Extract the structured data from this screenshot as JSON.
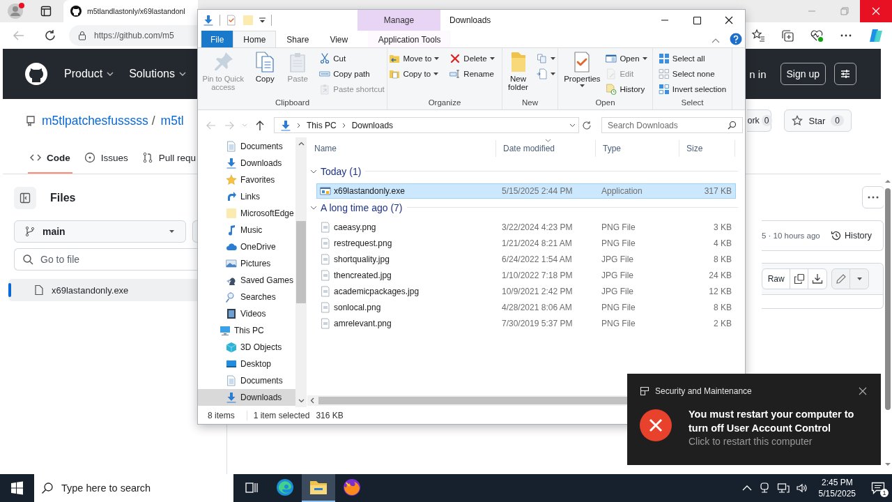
{
  "browser": {
    "tab": {
      "title": "m5tlandlastonly/x69lastandonl"
    },
    "url": "https://github.com/m5"
  },
  "github": {
    "nav": [
      "Product",
      "Solutions"
    ],
    "sign_in": "n in",
    "sign_up": "Sign up",
    "repo": {
      "owner": "m5tlpatchesfusssss",
      "separator": "/",
      "name": "m5tl"
    },
    "tabs": [
      {
        "label": "Code",
        "selected": true
      },
      {
        "label": "Issues",
        "selected": false
      },
      {
        "label": "Pull requ",
        "selected": false
      }
    ],
    "fork": {
      "label": "ork",
      "count": "0"
    },
    "star": {
      "label": "Star",
      "count": "0"
    },
    "sidebar": {
      "title": "Files",
      "branch": "main",
      "search": {
        "placeholder": "Go to file"
      },
      "files": [
        {
          "name": "x69lastandonly.exe",
          "selected": true
        }
      ]
    },
    "commit": {
      "info": "5 · 10 hours ago",
      "history": "History"
    },
    "file_toolbar": {
      "raw": "Raw"
    }
  },
  "explorer": {
    "title": "Downloads",
    "context_tab": "Manage",
    "ribbon_tabs": [
      {
        "label": "File",
        "kind": "file",
        "selected": false
      },
      {
        "label": "Home",
        "kind": "tab",
        "selected": true
      },
      {
        "label": "Share",
        "kind": "tab",
        "selected": false
      },
      {
        "label": "View",
        "kind": "tab",
        "selected": false
      },
      {
        "label": "Application Tools",
        "kind": "context",
        "selected": false
      }
    ],
    "ribbon_groups": [
      {
        "label": "Clipboard",
        "columns": [
          [
            {
              "label": "Pin to Quick access",
              "kind": "large",
              "menu": false,
              "disabled": true
            }
          ],
          [
            {
              "label": "Copy",
              "kind": "large",
              "menu": false,
              "disabled": false
            }
          ],
          [
            {
              "label": "Paste",
              "kind": "large",
              "menu": false,
              "disabled": true
            }
          ],
          [
            {
              "label": "Cut",
              "kind": "small",
              "menu": false,
              "disabled": false
            },
            {
              "label": "Copy path",
              "kind": "small",
              "menu": false,
              "disabled": false
            },
            {
              "label": "Paste shortcut",
              "kind": "small",
              "menu": false,
              "disabled": true
            }
          ]
        ]
      },
      {
        "label": "Organize",
        "columns": [
          [
            {
              "label": "Move to",
              "kind": "small",
              "menu": true,
              "disabled": false
            },
            {
              "label": "Copy to",
              "kind": "small",
              "menu": true,
              "disabled": false
            }
          ],
          [
            {
              "label": "Delete",
              "kind": "small",
              "menu": true,
              "disabled": false
            },
            {
              "label": "Rename",
              "kind": "small",
              "menu": false,
              "disabled": false
            }
          ]
        ]
      },
      {
        "label": "New",
        "columns": [
          [
            {
              "label": "New folder",
              "kind": "large",
              "menu": false,
              "disabled": false
            }
          ],
          [
            {
              "kind": "icon",
              "menu": true,
              "disabled": false
            },
            {
              "kind": "icon",
              "menu": true,
              "disabled": false
            }
          ]
        ]
      },
      {
        "label": "Open",
        "columns": [
          [
            {
              "label": "Properties",
              "kind": "large",
              "menu": true,
              "disabled": false
            }
          ],
          [
            {
              "label": "Open",
              "kind": "small",
              "menu": true,
              "disabled": false
            },
            {
              "label": "Edit",
              "kind": "small",
              "menu": false,
              "disabled": true
            },
            {
              "label": "History",
              "kind": "small",
              "menu": false,
              "disabled": false
            }
          ]
        ]
      },
      {
        "label": "Select",
        "columns": [
          [
            {
              "label": "Select all",
              "kind": "small",
              "menu": false,
              "disabled": false
            },
            {
              "label": "Select none",
              "kind": "small",
              "menu": false,
              "disabled": false
            },
            {
              "label": "Invert selection",
              "kind": "small",
              "menu": false,
              "disabled": false
            }
          ]
        ]
      }
    ],
    "navigation": {
      "back": {
        "disabled": true
      },
      "forward": {
        "disabled": true
      },
      "up": {
        "disabled": false
      }
    },
    "address": {
      "path": [
        "This PC",
        "Downloads"
      ]
    },
    "search": {
      "placeholder": "Search Downloads"
    },
    "nav_pane": {
      "folders": [
        {
          "label": "Documents",
          "selected": false
        },
        {
          "label": "Downloads",
          "selected": false
        },
        {
          "label": "Favorites",
          "selected": false
        },
        {
          "label": "Links",
          "selected": false
        },
        {
          "label": "MicrosoftEdge",
          "selected": false
        },
        {
          "label": "Music",
          "selected": false
        },
        {
          "label": "OneDrive",
          "selected": false
        },
        {
          "label": "Pictures",
          "selected": false
        },
        {
          "label": "Saved Games",
          "selected": false
        },
        {
          "label": "Searches",
          "selected": false
        },
        {
          "label": "Videos",
          "selected": false
        }
      ],
      "this_pc": {
        "label": "This PC",
        "selected": false,
        "children": [
          {
            "label": "3D Objects",
            "selected": false
          },
          {
            "label": "Desktop",
            "selected": false
          },
          {
            "label": "Documents",
            "selected": false
          },
          {
            "label": "Downloads",
            "selected": true
          }
        ]
      }
    },
    "columns": [
      {
        "label": "Name",
        "sorted": false
      },
      {
        "label": "Date modified",
        "sorted": true
      },
      {
        "label": "Type",
        "sorted": false
      },
      {
        "label": "Size",
        "sorted": false
      }
    ],
    "groups": [
      {
        "label": "Today (1)",
        "expanded": true,
        "files": [
          {
            "name": "x69lastandonly.exe",
            "date": "5/15/2025 2:44 PM",
            "type": "Application",
            "size": "317 KB",
            "kind": "application",
            "selected": true
          }
        ]
      },
      {
        "label": "A long time ago (7)",
        "expanded": true,
        "files": [
          {
            "name": "caeasy.png",
            "date": "3/22/2024 4:23 PM",
            "type": "PNG File",
            "size": "3 KB",
            "kind": "file",
            "selected": false
          },
          {
            "name": "restrequest.png",
            "date": "1/21/2024 8:21 AM",
            "type": "PNG File",
            "size": "4 KB",
            "kind": "file",
            "selected": false
          },
          {
            "name": "shortquality.jpg",
            "date": "6/24/2022 1:54 AM",
            "type": "JPG File",
            "size": "8 KB",
            "kind": "file",
            "selected": false
          },
          {
            "name": "thencreated.jpg",
            "date": "1/10/2022 7:18 PM",
            "type": "JPG File",
            "size": "24 KB",
            "kind": "file",
            "selected": false
          },
          {
            "name": "academicpackages.jpg",
            "date": "10/9/2021 2:42 PM",
            "type": "JPG File",
            "size": "12 KB",
            "kind": "file",
            "selected": false
          },
          {
            "name": "sonlocal.png",
            "date": "4/28/2021 8:06 AM",
            "type": "PNG File",
            "size": "8 KB",
            "kind": "file",
            "selected": false
          },
          {
            "name": "amrelevant.png",
            "date": "7/30/2019 5:37 PM",
            "type": "PNG File",
            "size": "2 KB",
            "kind": "file",
            "selected": false
          }
        ]
      }
    ],
    "status_bar": {
      "count": "8 items",
      "selection": "1 item selected",
      "size": "316 KB"
    }
  },
  "toast": {
    "app": "Security and Maintenance",
    "title": "You must restart your computer to turn off User Account Control",
    "body": "Click to restart this computer"
  },
  "taskbar": {
    "search": {
      "placeholder": "Type here to search"
    },
    "apps": [
      {
        "active": false
      },
      {
        "active": true
      },
      {
        "active": false
      }
    ],
    "time": "2:45 PM",
    "date": "5/15/2025",
    "notifications": "1"
  }
}
